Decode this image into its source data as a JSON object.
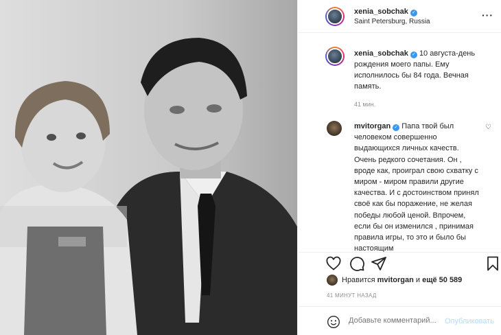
{
  "post": {
    "author": "xenia_sobchak",
    "location": "Saint Petersburg, Russia",
    "caption_author": "xenia_sobchak",
    "caption_text": "10 августа-день рождения моего папы. Ему исполнилось бы 84 года. Вечная память.",
    "caption_time": "41 мин.",
    "more_icon": "more-horizontal-icon"
  },
  "comment": {
    "author": "mvitorgan",
    "text": "Папа твой был человеком совершенно выдающихся личных качеств. Очень редкого сочетания. Он , вроде как, проиграл свою схватку с миром - миром правили другие качества. И с достоинством принял своё как бы поражение, не желая победы любой ценой. Впрочем, если бы он изменился , принимая правила игры, то это и было бы настоящим"
  },
  "likes": {
    "prefix": "Нравится",
    "user": "mvitorgan",
    "middle": "и",
    "others": "ещё 50 589"
  },
  "posted_time": "41 МИНУТ НАЗАД",
  "add_comment": {
    "placeholder": "Добавьте комментарий...",
    "publish_label": "Опубликовать"
  },
  "icons": [
    "heart-icon",
    "comment-icon",
    "share-icon",
    "bookmark-icon",
    "emoji-icon",
    "verified-icon"
  ],
  "colors": {
    "verified": "#3897f0",
    "publish_disabled": "#b3dbff",
    "meta_text": "#8e8e8e"
  }
}
